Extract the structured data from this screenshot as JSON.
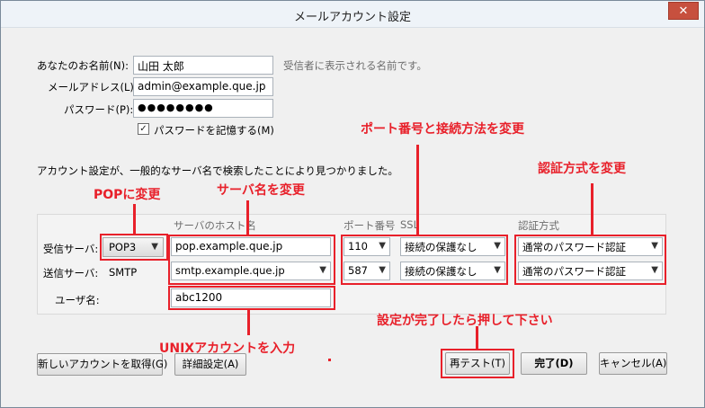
{
  "window": {
    "title": "メールアカウント設定",
    "close_label": "✕"
  },
  "identity": {
    "name_label": "あなたのお名前(N):",
    "name_value": "山田 太郎",
    "name_hint": "受信者に表示される名前です。",
    "email_label": "メールアドレス(L):",
    "email_value": "admin@example.que.jp",
    "password_label": "パスワード(P):",
    "password_value": "●●●●●●●●",
    "remember_label": "パスワードを記憶する(M)",
    "remember_checked": true
  },
  "status_text": "アカウント設定が、一般的なサーバ名で検索したことにより見つかりました。",
  "columns": {
    "hostname": "サーバのホスト名",
    "port": "ポート番号",
    "ssl": "SSL",
    "auth": "認証方式"
  },
  "incoming": {
    "label": "受信サーバ:",
    "protocol": "POP3",
    "host": "pop.example.que.jp",
    "port": "110",
    "ssl": "接続の保護なし",
    "auth": "通常のパスワード認証"
  },
  "outgoing": {
    "label": "送信サーバ:",
    "protocol": "SMTP",
    "host": "smtp.example.que.jp",
    "port": "587",
    "ssl": "接続の保護なし",
    "auth": "通常のパスワード認証"
  },
  "username": {
    "label": "ユーザ名:",
    "value": "abc1200"
  },
  "buttons": {
    "new_account": "新しいアカウントを取得(G)",
    "advanced": "詳細設定(A)",
    "retest": "再テスト(T)",
    "done": "完了(D)",
    "cancel": "キャンセル(A)"
  },
  "annotations": {
    "pop": "POPに変更",
    "server": "サーバ名を変更",
    "port": "ポート番号と接続方法を変更",
    "auth": "認証方式を変更",
    "unix": "UNIXアカウントを入力",
    "retest": "設定が完了したら押して下さい"
  },
  "colors": {
    "annotation": "#e8202a"
  }
}
